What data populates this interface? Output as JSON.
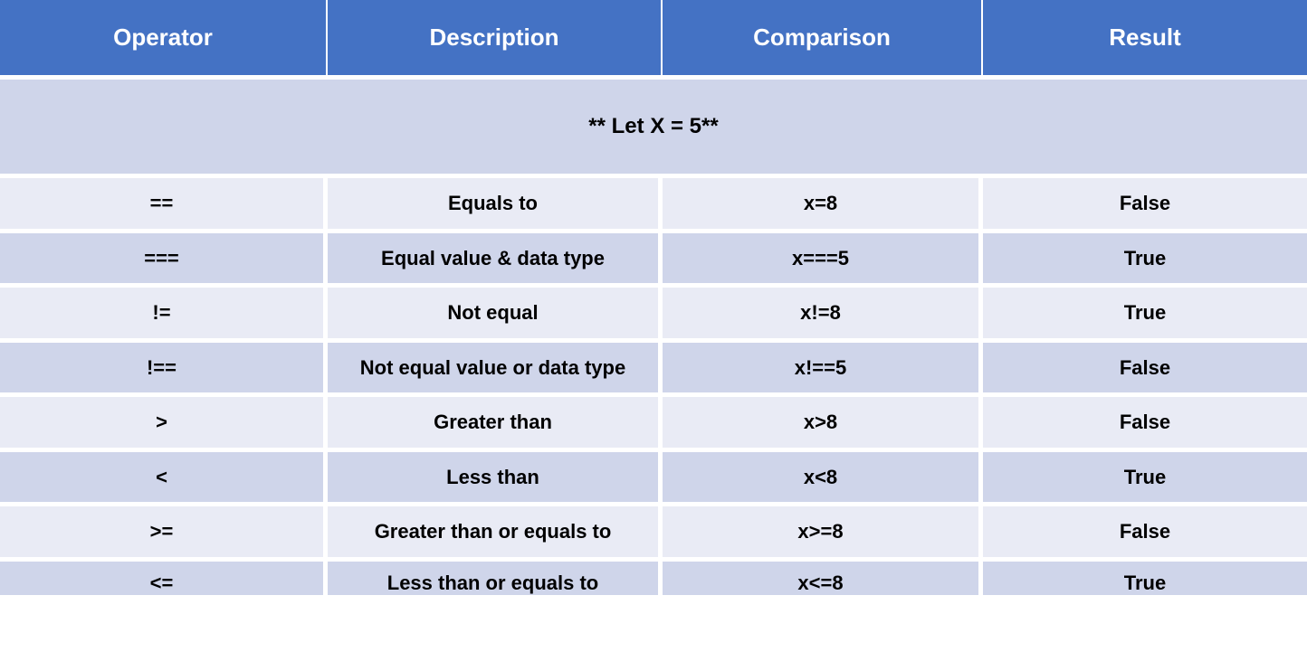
{
  "headers": [
    "Operator",
    "Description",
    "Comparison",
    "Result"
  ],
  "banner": "** Let X = 5**",
  "rows": [
    {
      "operator": "==",
      "description": "Equals to",
      "comparison": "x=8",
      "result": "False"
    },
    {
      "operator": "===",
      "description": "Equal value & data type",
      "comparison": "x===5",
      "result": "True"
    },
    {
      "operator": "!=",
      "description": "Not equal",
      "comparison": "x!=8",
      "result": "True"
    },
    {
      "operator": "!==",
      "description": "Not equal value or data type",
      "comparison": "x!==5",
      "result": "False"
    },
    {
      "operator": ">",
      "description": "Greater than",
      "comparison": "x>8",
      "result": "False"
    },
    {
      "operator": "<",
      "description": "Less than",
      "comparison": "x<8",
      "result": "True"
    },
    {
      "operator": ">=",
      "description": "Greater than or equals to",
      "comparison": "x>=8",
      "result": "False"
    },
    {
      "operator": "<=",
      "description": "Less than or equals to",
      "comparison": "x<=8",
      "result": "True"
    }
  ],
  "colors": {
    "header_bg": "#4472c4",
    "row_even": "#e9ebf5",
    "row_odd": "#cfd5ea",
    "gap": "#ffffff"
  },
  "chart_data": {
    "type": "table",
    "title": "Comparison Operators (Let X = 5)",
    "columns": [
      "Operator",
      "Description",
      "Comparison",
      "Result"
    ],
    "rows": [
      [
        "==",
        "Equals to",
        "x=8",
        "False"
      ],
      [
        "===",
        "Equal value & data type",
        "x===5",
        "True"
      ],
      [
        "!=",
        "Not equal",
        "x!=8",
        "True"
      ],
      [
        "!==",
        "Not equal value or data type",
        "x!==5",
        "False"
      ],
      [
        ">",
        "Greater than",
        "x>8",
        "False"
      ],
      [
        "<",
        "Less than",
        "x<8",
        "True"
      ],
      [
        ">=",
        "Greater than or equals to",
        "x>=8",
        "False"
      ],
      [
        "<=",
        "Less than or equals to",
        "x<=8",
        "True"
      ]
    ]
  }
}
